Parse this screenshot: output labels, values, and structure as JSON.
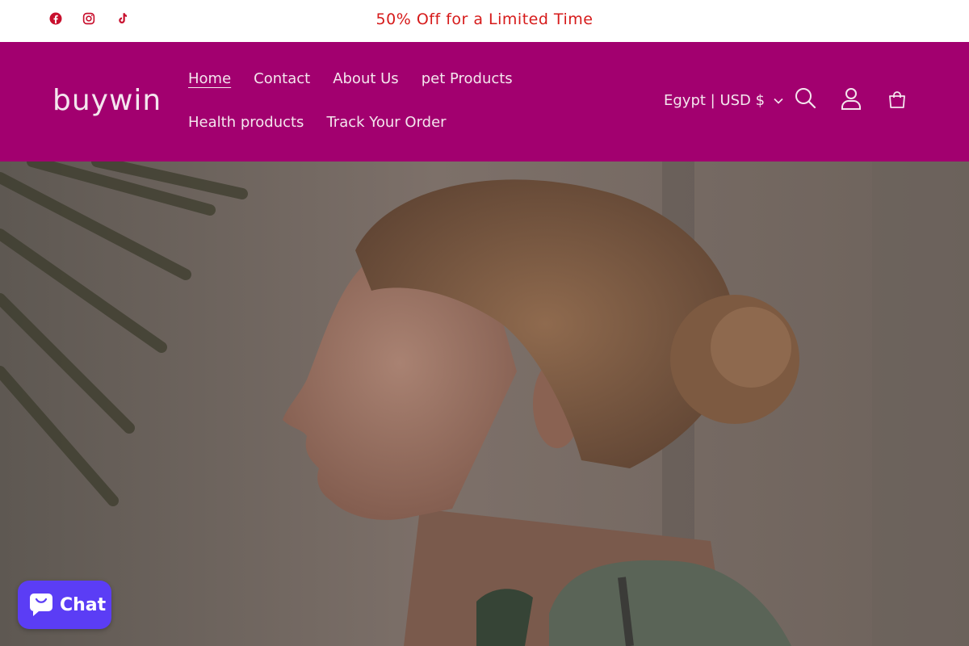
{
  "announcement": {
    "text": "50% Off for a Limited Time",
    "social": [
      {
        "name": "facebook-icon",
        "label": "Facebook"
      },
      {
        "name": "instagram-icon",
        "label": "Instagram"
      },
      {
        "name": "tiktok-icon",
        "label": "TikTok"
      }
    ]
  },
  "header": {
    "logo": "buywin",
    "nav": [
      "Home",
      "Contact",
      "About Us",
      "pet Products",
      "Health products",
      "Track Your Order"
    ],
    "active_nav": "Home",
    "locale": "Egypt | USD $",
    "icons": [
      "search-icon",
      "account-icon",
      "cart-icon"
    ]
  },
  "chat": {
    "label": "Chat",
    "icon": "chat-bubble-icon"
  },
  "colors": {
    "header_bg": "#a2006f",
    "announcement_text": "#d61a1a",
    "chat_bg": "#5b3df5"
  }
}
